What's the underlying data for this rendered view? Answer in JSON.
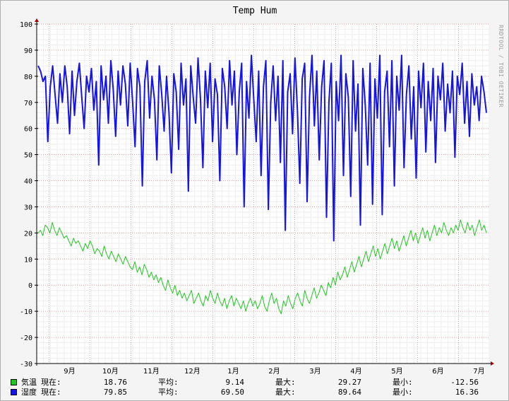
{
  "watermark": "RRDTOOL / TOBI OETIKER",
  "colors": {
    "temp": "#1fc81f",
    "hum": "#1414e6",
    "grid": "#e6a0a0",
    "axis": "#000000",
    "plot_bg": "#ffffff"
  },
  "chart_data": {
    "type": "line",
    "title": "Temp Hum",
    "ylim": [
      -30,
      100
    ],
    "yticks": [
      -30,
      -20,
      -10,
      0,
      10,
      20,
      30,
      40,
      50,
      60,
      70,
      80,
      90,
      100
    ],
    "ytick_labels": [
      "-30",
      "-20",
      "-10",
      "0",
      "10",
      "20",
      "30",
      "40",
      "50",
      "60",
      "70",
      "80",
      "90",
      "100"
    ],
    "x_ticks": [
      "9月",
      "10月",
      "11月",
      "12月",
      "1月",
      "2月",
      "3月",
      "4月",
      "5月",
      "6月",
      "7月"
    ],
    "grid": true,
    "legend_position": "bottom-left",
    "series": [
      {
        "name": "気温",
        "color": "#1fc81f",
        "values": [
          20,
          21,
          19,
          23,
          22,
          20,
          24,
          21,
          19,
          22,
          20,
          18,
          19,
          17,
          15,
          18,
          16,
          17,
          15,
          13,
          16,
          14,
          17,
          15,
          12,
          14,
          13,
          11,
          15,
          12,
          10,
          13,
          11,
          9,
          12,
          10,
          8,
          11,
          9,
          7,
          6,
          9,
          5,
          7,
          4,
          8,
          6,
          3,
          5,
          2,
          4,
          1,
          3,
          0,
          -2,
          2,
          -1,
          -3,
          0,
          -4,
          -2,
          -5,
          -3,
          -6,
          -4,
          -2,
          -7,
          -5,
          -3,
          -6,
          -8,
          -4,
          -6,
          -2,
          -5,
          -7,
          -3,
          -6,
          -8,
          -5,
          -9,
          -6,
          -4,
          -8,
          -5,
          -7,
          -9,
          -6,
          -10,
          -7,
          -5,
          -8,
          -6,
          -9,
          -7,
          -4,
          -8,
          -10,
          -6,
          -3,
          -7,
          -5,
          -9,
          -11,
          -6,
          -8,
          -4,
          -7,
          -9,
          -5,
          -3,
          -6,
          -8,
          -2,
          -5,
          -7,
          -4,
          -1,
          -5,
          -3,
          0,
          -2,
          -4,
          1,
          -1,
          3,
          0,
          5,
          2,
          4,
          7,
          3,
          6,
          9,
          5,
          8,
          11,
          7,
          10,
          13,
          9,
          12,
          15,
          11,
          14,
          10,
          13,
          16,
          12,
          15,
          18,
          14,
          17,
          13,
          16,
          19,
          15,
          18,
          21,
          17,
          20,
          16,
          19,
          22,
          18,
          21,
          17,
          20,
          23,
          19,
          22,
          20,
          24,
          21,
          19,
          22,
          20,
          23,
          21,
          25,
          22,
          20,
          24,
          21,
          23,
          19,
          22,
          25,
          21,
          23,
          20
        ]
      },
      {
        "name": "湿度",
        "color": "#1414e6",
        "values": [
          84,
          82,
          78,
          80,
          55,
          76,
          84,
          73,
          62,
          81,
          70,
          84,
          76,
          58,
          82,
          65,
          78,
          85,
          72,
          60,
          80,
          74,
          83,
          67,
          78,
          46,
          84,
          71,
          80,
          62,
          86,
          75,
          57,
          82,
          69,
          84,
          77,
          61,
          85,
          70,
          53,
          83,
          76,
          38,
          78,
          86,
          64,
          80,
          71,
          48,
          84,
          73,
          59,
          80,
          66,
          43,
          81,
          74,
          52,
          85,
          69,
          79,
          36,
          84,
          72,
          62,
          87,
          71,
          45,
          82,
          68,
          85,
          55,
          79,
          73,
          40,
          83,
          76,
          60,
          86,
          69,
          82,
          50,
          74,
          85,
          30,
          78,
          64,
          88,
          71,
          55,
          82,
          42,
          76,
          86,
          29,
          70,
          84,
          63,
          80,
          47,
          86,
          21,
          74,
          81,
          58,
          87,
          67,
          39,
          79,
          85,
          32,
          72,
          88,
          61,
          82,
          48,
          76,
          86,
          26,
          70,
          85,
          17,
          78,
          63,
          88,
          42,
          81,
          72,
          34,
          86,
          59,
          77,
          23,
          83,
          69,
          46,
          85,
          31,
          79,
          64,
          88,
          27,
          74,
          82,
          53,
          86,
          38,
          80,
          67,
          88,
          45,
          73,
          84,
          56,
          76,
          41,
          82,
          68,
          85,
          51,
          78,
          63,
          83,
          47,
          80,
          71,
          85,
          59,
          77,
          66,
          82,
          49,
          80,
          73,
          85,
          62,
          78,
          57,
          81,
          69,
          76,
          63,
          80,
          74,
          66
        ]
      }
    ]
  },
  "legend": [
    {
      "name": "気温",
      "cur_label": "現在:",
      "cur": "18.76",
      "avg_label": "平均:",
      "avg": "9.14",
      "max_label": "最大:",
      "max": "29.27",
      "min_label": "最小:",
      "min": "-12.56"
    },
    {
      "name": "湿度",
      "cur_label": "現在:",
      "cur": "79.85",
      "avg_label": "平均:",
      "avg": "69.50",
      "max_label": "最大:",
      "max": "89.64",
      "min_label": "最小:",
      "min": "16.36"
    }
  ]
}
